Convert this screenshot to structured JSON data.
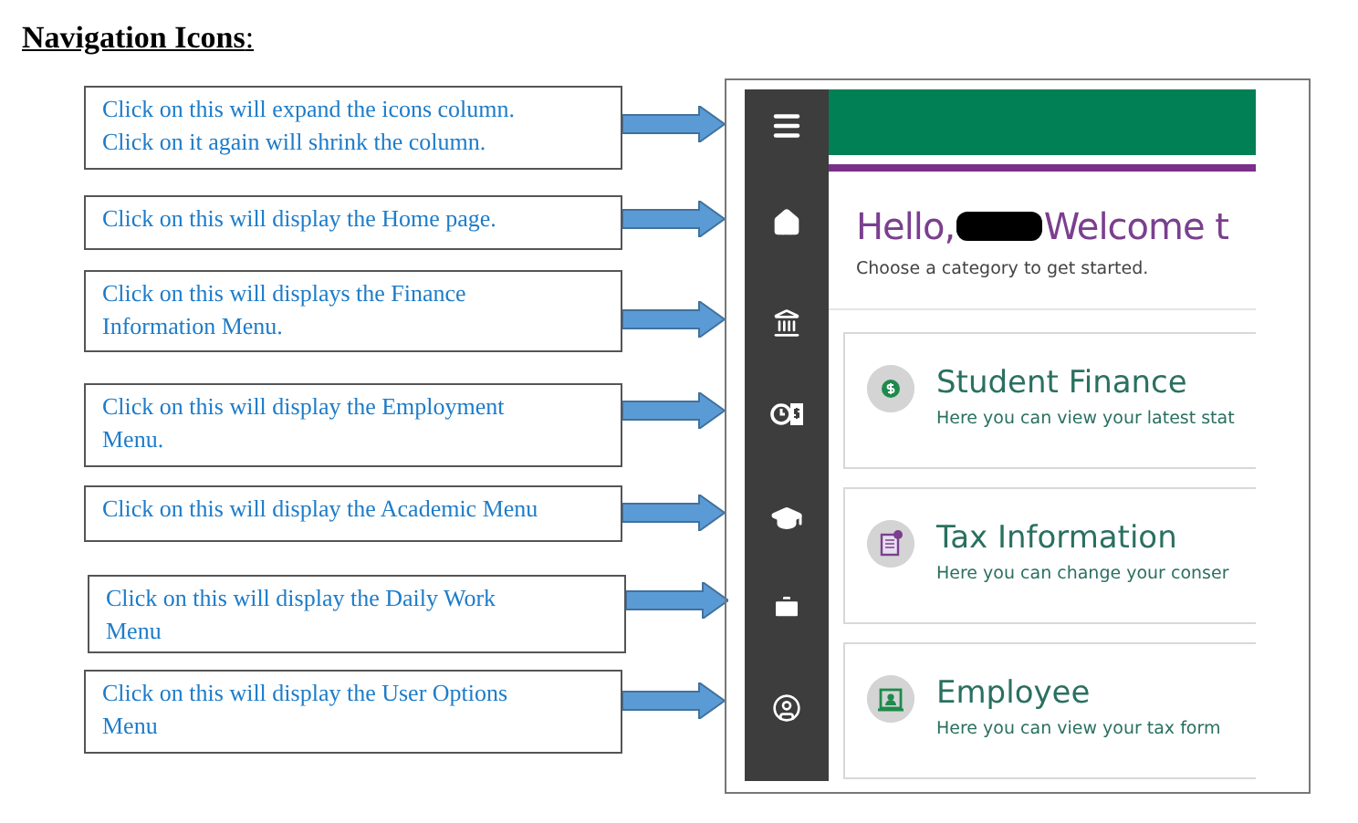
{
  "heading": "**Navigation Icons**:",
  "callouts": [
    {
      "lines": [
        "Click on this will expand the icons column.",
        "Click on it again will shrink the column."
      ]
    },
    {
      "lines": [
        "Click on this will display the Home page."
      ]
    },
    {
      "lines": [
        "Click on this will displays the Finance",
        "Information Menu."
      ]
    },
    {
      "lines": [
        "Click on this will display the Employment",
        "Menu."
      ]
    },
    {
      "lines": [
        "Click on this will display the Academic Menu"
      ]
    },
    {
      "lines": [
        "Click on this will display the Daily Work",
        "Menu"
      ]
    },
    {
      "lines": [
        "Click on this will display the User Options",
        "Menu"
      ]
    }
  ],
  "screenshot": {
    "greeting": "Hello,",
    "welcome": "Welcome t",
    "subtitle": "Choose a category to get started.",
    "sidebar": [
      {
        "kind": "menu"
      },
      {
        "kind": "home"
      },
      {
        "kind": "bank"
      },
      {
        "kind": "clock-dollar"
      },
      {
        "kind": "cap"
      },
      {
        "kind": "briefcase"
      },
      {
        "kind": "user"
      }
    ],
    "cards": [
      {
        "kind": "finance",
        "title": "Student Finance",
        "description": "Here you can view your latest stat"
      },
      {
        "kind": "tax",
        "title": "Tax Information",
        "description": "Here you can change your conser"
      },
      {
        "kind": "employee",
        "title": "Employee",
        "description": "Here you can view your tax form"
      }
    ]
  }
}
